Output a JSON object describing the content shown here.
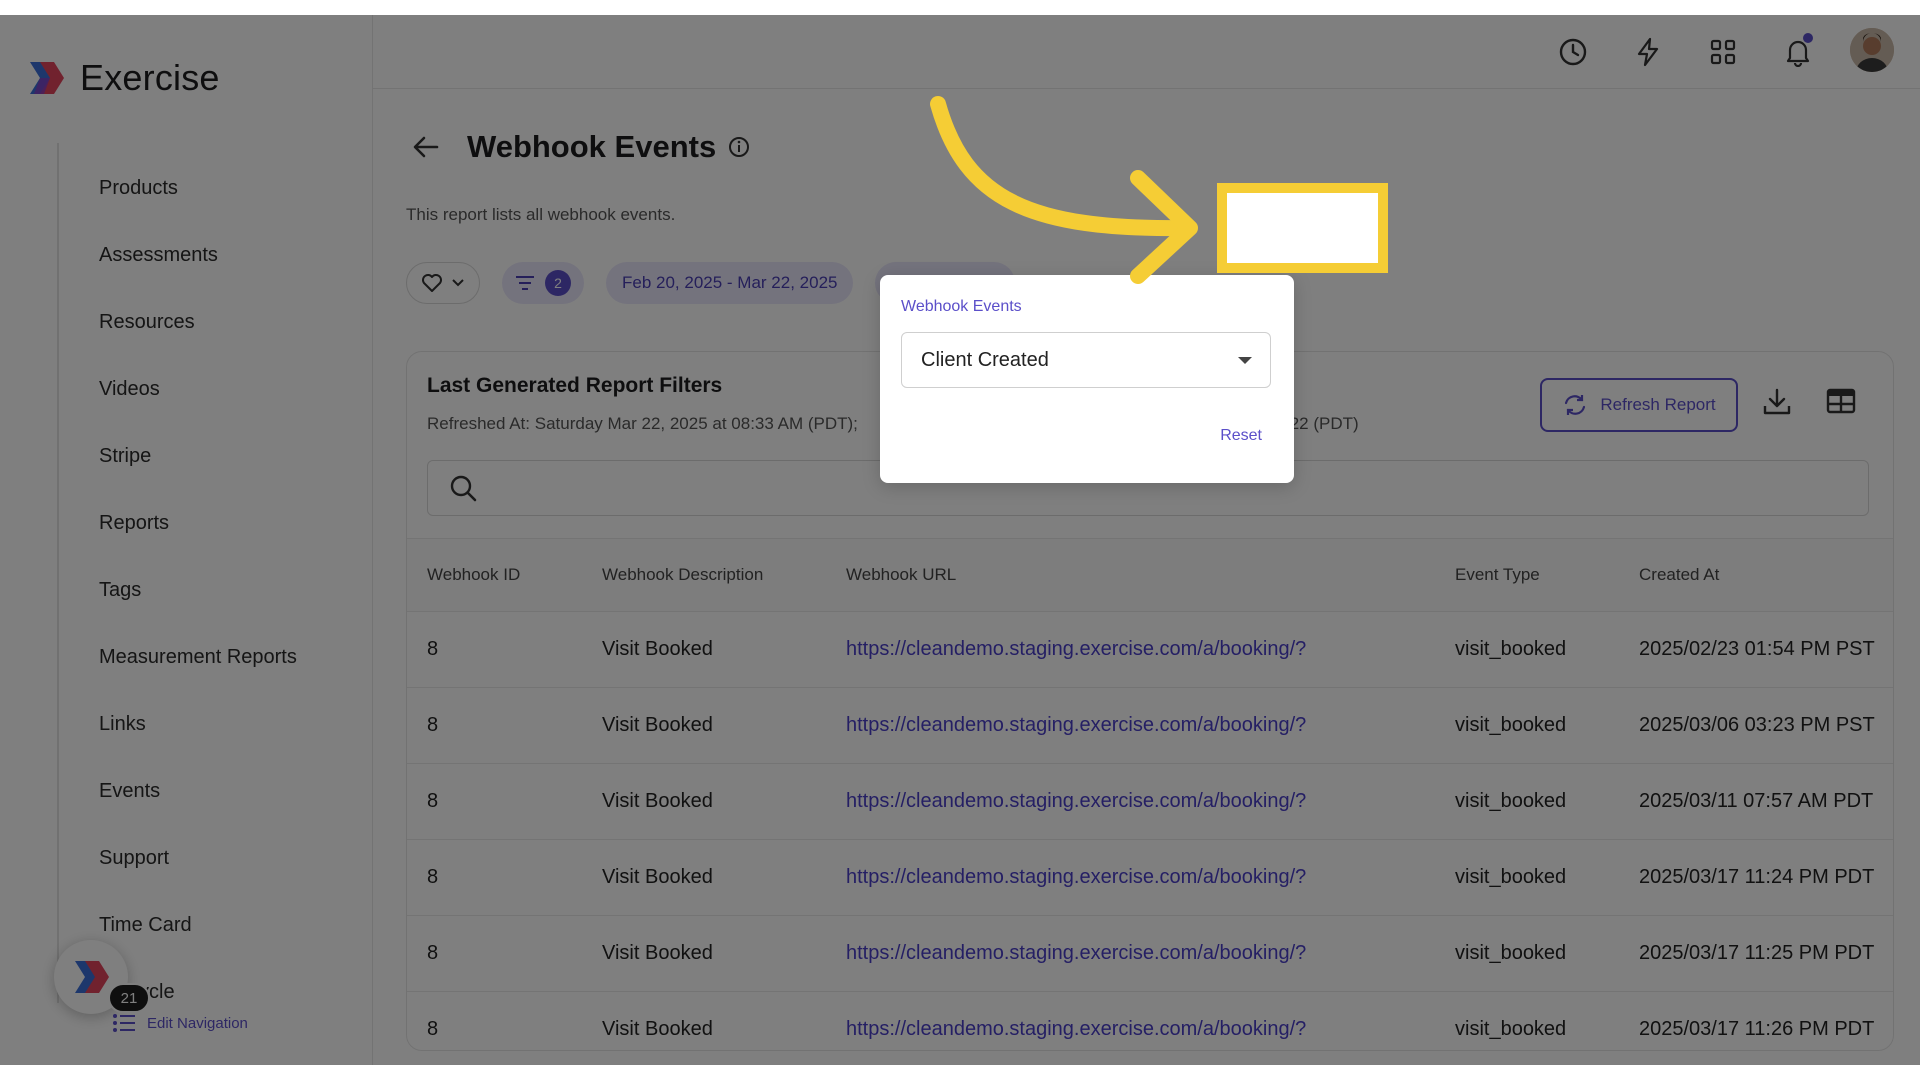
{
  "brand": {
    "name": "Exercise"
  },
  "sidebar": {
    "items": [
      {
        "label": "Products"
      },
      {
        "label": "Assessments"
      },
      {
        "label": "Resources"
      },
      {
        "label": "Videos"
      },
      {
        "label": "Stripe"
      },
      {
        "label": "Reports"
      },
      {
        "label": "Tags"
      },
      {
        "label": "Measurement Reports"
      },
      {
        "label": "Links"
      },
      {
        "label": "Events"
      },
      {
        "label": "Support"
      },
      {
        "label": "Time Card"
      },
      {
        "label": "ycycle"
      }
    ],
    "badge_count": "21",
    "edit_nav_label": "Edit Navigation"
  },
  "topbar": {
    "icons": [
      "clock-icon",
      "lightning-icon",
      "grid-icon",
      "bell-icon"
    ],
    "has_notification": true
  },
  "page": {
    "title": "Webhook Events",
    "description": "This report lists all webhook events.",
    "filters": {
      "filter_count": "2",
      "date_range": "Feb 20, 2025 - Mar 22, 2025"
    }
  },
  "report": {
    "title": "Last Generated Report Filters",
    "refreshed_at": "Refreshed At: Saturday Mar 22, 2025 at 08:33 AM (PDT);",
    "refreshed_tail": "/22 (PDT)",
    "refresh_label": "Refresh Report"
  },
  "table": {
    "columns": [
      "Webhook ID",
      "Webhook Description",
      "Webhook URL",
      "Event Type",
      "Created At"
    ],
    "rows": [
      [
        "8",
        "Visit Booked",
        "https://cleandemo.staging.exercise.com/a/booking/?",
        "visit_booked",
        "2025/02/23 01:54 PM PST"
      ],
      [
        "8",
        "Visit Booked",
        "https://cleandemo.staging.exercise.com/a/booking/?",
        "visit_booked",
        "2025/03/06 03:23 PM PST"
      ],
      [
        "8",
        "Visit Booked",
        "https://cleandemo.staging.exercise.com/a/booking/?",
        "visit_booked",
        "2025/03/11 07:57 AM PDT"
      ],
      [
        "8",
        "Visit Booked",
        "https://cleandemo.staging.exercise.com/a/booking/?",
        "visit_booked",
        "2025/03/17 11:24 PM PDT"
      ],
      [
        "8",
        "Visit Booked",
        "https://cleandemo.staging.exercise.com/a/booking/?",
        "visit_booked",
        "2025/03/17 11:25 PM PDT"
      ],
      [
        "8",
        "Visit Booked",
        "https://cleandemo.staging.exercise.com/a/booking/?",
        "visit_booked",
        "2025/03/17 11:26 PM PDT"
      ]
    ]
  },
  "popover": {
    "label": "Webhook Events",
    "selected": "Client Created",
    "reset_label": "Reset"
  },
  "colors": {
    "accent": "#5b4fc9",
    "highlight": "#f5cd35"
  }
}
